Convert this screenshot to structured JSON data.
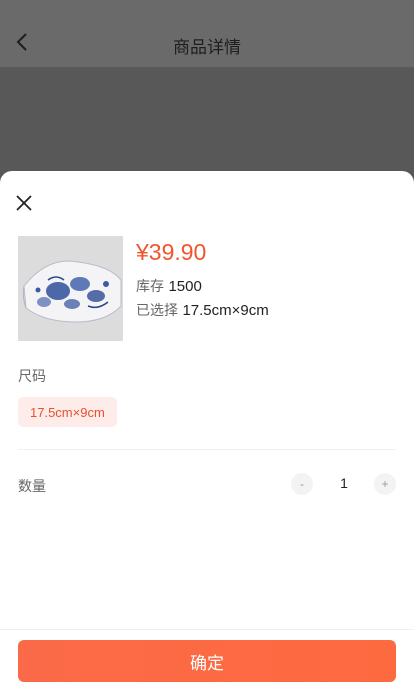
{
  "header": {
    "title": "商品详情",
    "back_icon": "chevron-left-icon"
  },
  "sheet": {
    "close_icon": "close-icon",
    "product": {
      "price": "¥39.90",
      "stock_label": "库存",
      "stock_value": "1500",
      "selected_label": "已选择",
      "selected_value": "17.5cm×9cm"
    },
    "size": {
      "label": "尺码",
      "options": [
        "17.5cm×9cm"
      ],
      "selected": "17.5cm×9cm"
    },
    "quantity": {
      "label": "数量",
      "minus": "-",
      "value": "1",
      "plus": "+"
    },
    "confirm_label": "确定"
  },
  "colors": {
    "accent": "#f0562d",
    "chip_bg": "#fdecea",
    "button": "#fb6a48"
  }
}
